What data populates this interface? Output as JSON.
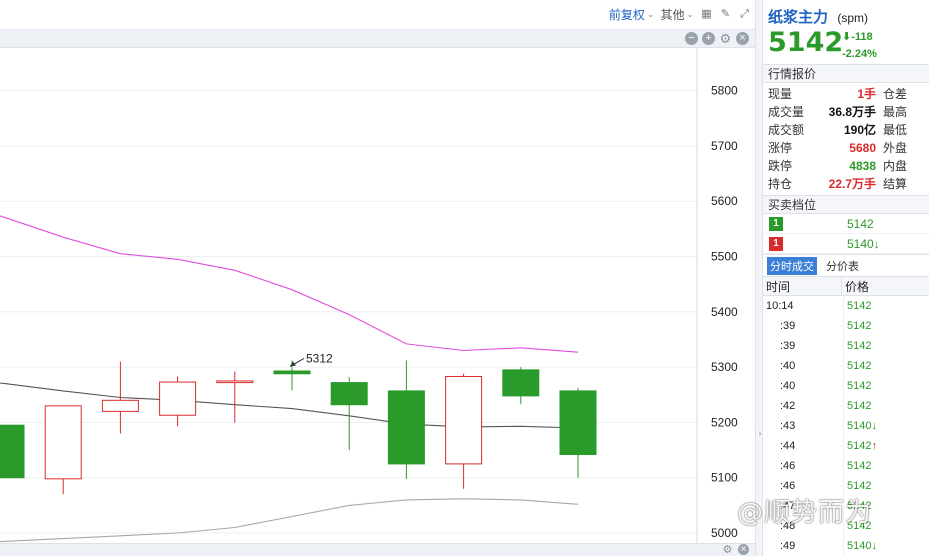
{
  "toolbar": {
    "adjust_label": "前复权",
    "other_label": "其他"
  },
  "chart_data": {
    "type": "candlestick",
    "yticks": [
      5800,
      5700,
      5600,
      5500,
      5400,
      5300,
      5200,
      5100,
      5000
    ],
    "ylim": [
      4982,
      5877
    ],
    "candles": [
      {
        "open": 5195,
        "close": 5100,
        "high": 5195,
        "low": 5100
      },
      {
        "open": 5098,
        "close": 5230,
        "high": 5230,
        "low": 5070
      },
      {
        "open": 5220,
        "close": 5240,
        "high": 5310,
        "low": 5180
      },
      {
        "open": 5213,
        "close": 5273,
        "high": 5283,
        "low": 5193
      },
      {
        "open": 5272,
        "close": 5275,
        "high": 5292,
        "low": 5200
      },
      {
        "open": 5293,
        "close": 5288,
        "high": 5312,
        "low": 5258
      },
      {
        "open": 5272,
        "close": 5232,
        "high": 5282,
        "low": 5150
      },
      {
        "open": 5257,
        "close": 5125,
        "high": 5312,
        "low": 5098
      },
      {
        "open": 5125,
        "close": 5283,
        "high": 5288,
        "low": 5080
      },
      {
        "open": 5295,
        "close": 5248,
        "high": 5300,
        "low": 5233
      },
      {
        "open": 5257,
        "close": 5142,
        "high": 5262,
        "low": 5100
      }
    ],
    "annotation": "5312",
    "ma_pink": [
      5570,
      5535,
      5505,
      5495,
      5475,
      5440,
      5395,
      5342,
      5330,
      5335,
      5327
    ],
    "ma_dark": [
      5270,
      5257,
      5245,
      5240,
      5232,
      5225,
      5212,
      5197,
      5192,
      5193,
      5190
    ],
    "ma_gray": [
      4985,
      4990,
      4995,
      5000,
      5010,
      5030,
      5050,
      5060,
      5062,
      5060,
      5052
    ]
  },
  "quote": {
    "name": "纸浆主力",
    "code": "(spm)",
    "price": "5142",
    "change": "-118",
    "pct": "-2.24%",
    "section_quote": "行情报价",
    "rows": [
      {
        "l1": "现量",
        "v": "1手",
        "c": "red",
        "l2": "仓差"
      },
      {
        "l1": "成交量",
        "v": "36.8万手",
        "c": "black",
        "l2": "最高"
      },
      {
        "l1": "成交额",
        "v": "190亿",
        "c": "black",
        "l2": "最低"
      },
      {
        "l1": "涨停",
        "v": "5680",
        "c": "red",
        "l2": "外盘"
      },
      {
        "l1": "跌停",
        "v": "4838",
        "c": "green",
        "l2": "内盘"
      },
      {
        "l1": "持仓",
        "v": "22.7万手",
        "c": "red",
        "l2": "结算"
      }
    ],
    "section_book": "买卖档位",
    "book": [
      {
        "badge": "1",
        "price": "5142",
        "arrow": ""
      },
      {
        "badge": "1",
        "price": "5140",
        "arrow": "↓"
      }
    ],
    "tab_ticks": "分时成交",
    "tab_price": "分价表",
    "col_time": "时间",
    "col_price": "价格",
    "ticks": [
      {
        "t": "10:14",
        "p": "5142",
        "a": "",
        "ac": ""
      },
      {
        "t": ":39",
        "p": "5142",
        "a": "",
        "ac": ""
      },
      {
        "t": ":39",
        "p": "5142",
        "a": "",
        "ac": ""
      },
      {
        "t": ":40",
        "p": "5142",
        "a": "",
        "ac": ""
      },
      {
        "t": ":40",
        "p": "5142",
        "a": "",
        "ac": ""
      },
      {
        "t": ":42",
        "p": "5142",
        "a": "",
        "ac": ""
      },
      {
        "t": ":43",
        "p": "5140",
        "a": "↓",
        "ac": "green"
      },
      {
        "t": ":44",
        "p": "5142",
        "a": "↑",
        "ac": "red"
      },
      {
        "t": ":46",
        "p": "5142",
        "a": "",
        "ac": ""
      },
      {
        "t": ":46",
        "p": "5142",
        "a": "",
        "ac": ""
      },
      {
        "t": ":47",
        "p": "5142",
        "a": "",
        "ac": ""
      },
      {
        "t": ":48",
        "p": "5142",
        "a": "",
        "ac": ""
      },
      {
        "t": ":49",
        "p": "5140",
        "a": "↓",
        "ac": "green"
      }
    ]
  },
  "watermark": "@顺势而为"
}
